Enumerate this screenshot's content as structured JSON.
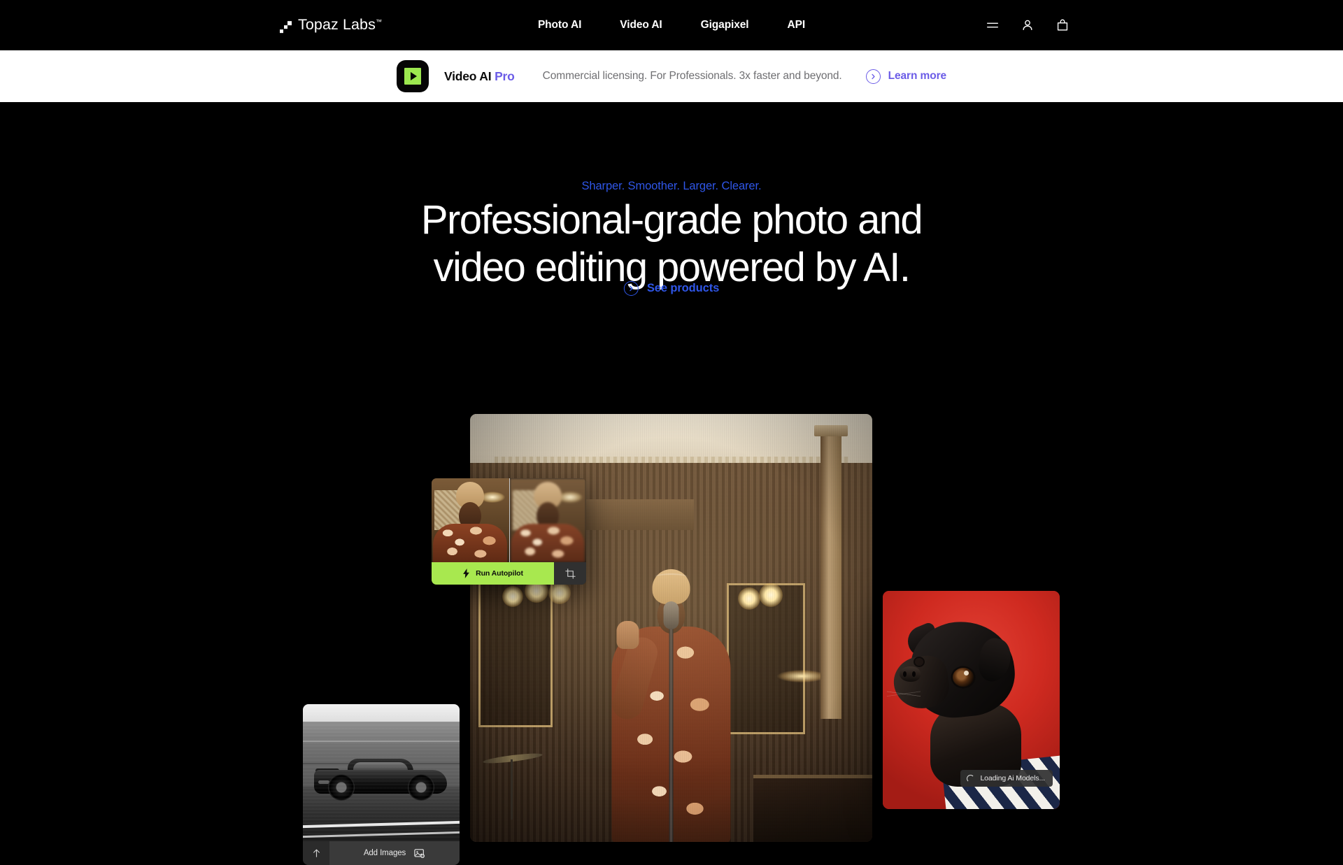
{
  "nav": {
    "logo_text": "Topaz Labs",
    "logo_tm": "™",
    "links": [
      {
        "label": "Photo AI"
      },
      {
        "label": "Video AI"
      },
      {
        "label": "Gigapixel"
      },
      {
        "label": "API"
      }
    ],
    "icons": [
      {
        "name": "menu-icon"
      },
      {
        "name": "account-icon"
      },
      {
        "name": "cart-icon"
      }
    ]
  },
  "banner": {
    "product_name": "Video AI",
    "product_tier": "Pro",
    "description": "Commercial licensing. For Professionals. 3x faster and beyond.",
    "cta_label": "Learn more",
    "accent_color": "#6b5ce7",
    "background_color": "#ffffff",
    "icon_color": "#9ce84f"
  },
  "hero": {
    "eyebrow": "Sharper. Smoother. Larger. Clearer.",
    "headline_line1": "Professional-grade photo and",
    "headline_line2": "video editing powered by AI.",
    "cta_label": "See products",
    "accent_color": "#2f56e8"
  },
  "showcase": {
    "photo_card": {
      "autopilot_label": "Run Autopilot",
      "crop_icon": "crop-icon",
      "bolt_icon": "lightning-bolt-icon",
      "button_color": "#a8e84f"
    },
    "gigapixel_card": {
      "add_images_label": "Add Images",
      "upload_icon": "upload-arrow-icon",
      "add_image_icon": "add-image-icon"
    },
    "pug_card": {
      "toast_label": "Loading Ai Models...",
      "spinner_icon": "loading-spinner-icon"
    }
  }
}
